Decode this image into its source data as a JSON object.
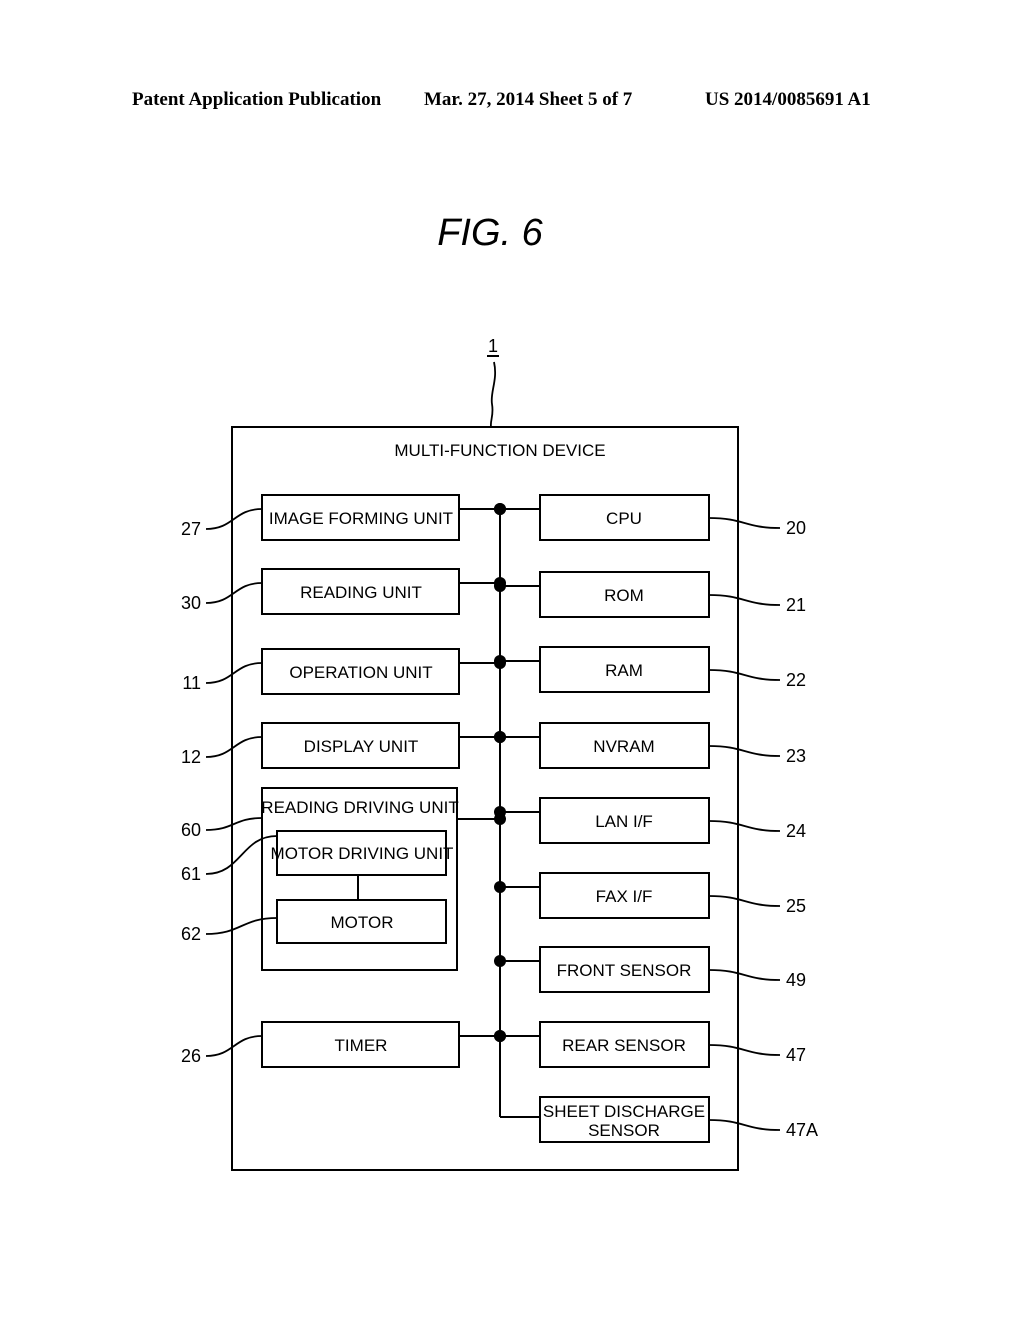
{
  "header": {
    "left": "Patent Application Publication",
    "middle": "Mar. 27, 2014  Sheet 5 of 7",
    "right": "US 2014/0085691 A1"
  },
  "figure": {
    "title": "FIG. 6",
    "device_ref": "1",
    "device_label": "MULTI-FUNCTION DEVICE",
    "left_blocks": [
      {
        "id": "image-forming-unit",
        "label": "IMAGE FORMING UNIT",
        "ref": "27"
      },
      {
        "id": "reading-unit",
        "label": "READING UNIT",
        "ref": "30"
      },
      {
        "id": "operation-unit",
        "label": "OPERATION UNIT",
        "ref": "11"
      },
      {
        "id": "display-unit",
        "label": "DISPLAY UNIT",
        "ref": "12"
      },
      {
        "id": "reading-driving-unit",
        "label": "READING DRIVING UNIT",
        "ref": "60",
        "children": [
          {
            "id": "motor-driving-unit",
            "label": "MOTOR DRIVING UNIT",
            "ref": "61"
          },
          {
            "id": "motor",
            "label": "MOTOR",
            "ref": "62"
          }
        ]
      },
      {
        "id": "timer",
        "label": "TIMER",
        "ref": "26"
      }
    ],
    "right_blocks": [
      {
        "id": "cpu",
        "label": "CPU",
        "ref": "20"
      },
      {
        "id": "rom",
        "label": "ROM",
        "ref": "21"
      },
      {
        "id": "ram",
        "label": "RAM",
        "ref": "22"
      },
      {
        "id": "nvram",
        "label": "NVRAM",
        "ref": "23"
      },
      {
        "id": "lan-if",
        "label": "LAN I/F",
        "ref": "24"
      },
      {
        "id": "fax-if",
        "label": "FAX I/F",
        "ref": "25"
      },
      {
        "id": "front-sensor",
        "label": "FRONT SENSOR",
        "ref": "49"
      },
      {
        "id": "rear-sensor",
        "label": "REAR SENSOR",
        "ref": "47"
      },
      {
        "id": "sheet-discharge-sensor",
        "label": [
          "SHEET DISCHARGE",
          "SENSOR"
        ],
        "ref": "47A"
      }
    ]
  }
}
